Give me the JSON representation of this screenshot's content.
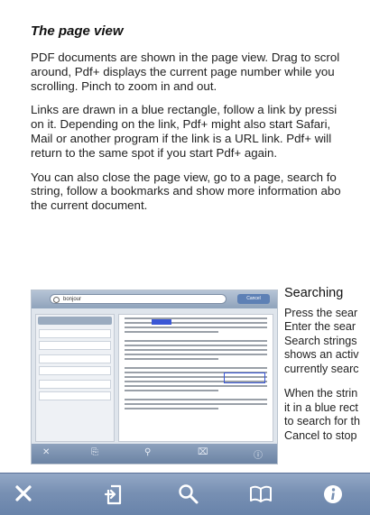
{
  "heading": "The page view",
  "paragraphs": [
    [
      "PDF documents are shown in the page view. Drag to scrol",
      "around, Pdf+ displays the current page number while you",
      "scrolling. Pinch to zoom in and out."
    ],
    [
      "Links are drawn in a blue rectangle, follow a link by pressi",
      "on it. Depending on the link, Pdf+ might also start Safari,",
      "Mail or another program if the link is a URL link. Pdf+ will",
      "return to the same spot if you start Pdf+ again."
    ],
    [
      "You can also close the page view, go to a page, search fo",
      "string, follow a bookmarks and show more information abo",
      "the current document."
    ]
  ],
  "sidebar_text": {
    "title": "Searching",
    "p1": [
      "Press the sear",
      "Enter the sear",
      "Search strings",
      "shows an activ",
      "currently searc"
    ],
    "p2": [
      "When the strin",
      "it in a blue rect",
      "to search for th",
      "Cancel to stop"
    ]
  },
  "thumbnail": {
    "search_value": "bonjour",
    "cancel_label": "Cancel"
  },
  "toolbar": {
    "icons": [
      "close-icon",
      "go-to-page-icon",
      "search-icon",
      "bookmarks-icon",
      "info-icon"
    ],
    "color": "#7890b3"
  }
}
